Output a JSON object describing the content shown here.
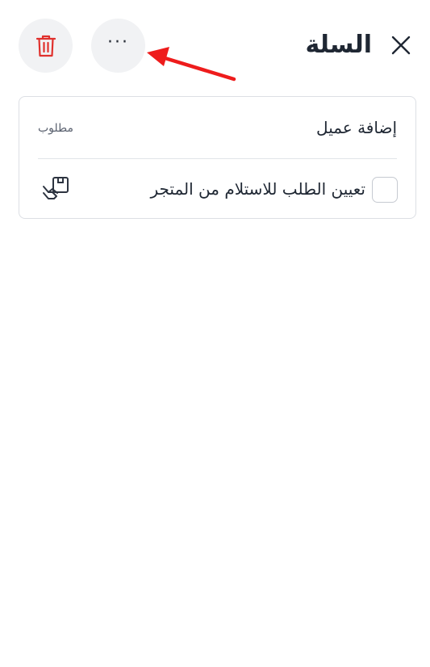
{
  "header": {
    "title": "السلة",
    "close_icon": "close-icon",
    "more_label": "···",
    "trash_icon": "trash-icon"
  },
  "customer": {
    "label": "إضافة عميل",
    "required": "مطلوب"
  },
  "pickup": {
    "label": "تعيين الطلب للاستلام من المتجر",
    "checked": false,
    "icon": "store-pickup-icon"
  },
  "colors": {
    "trash": "#e0312d",
    "arrow": "#ee1c1c",
    "button_bg": "#f1f2f4"
  }
}
